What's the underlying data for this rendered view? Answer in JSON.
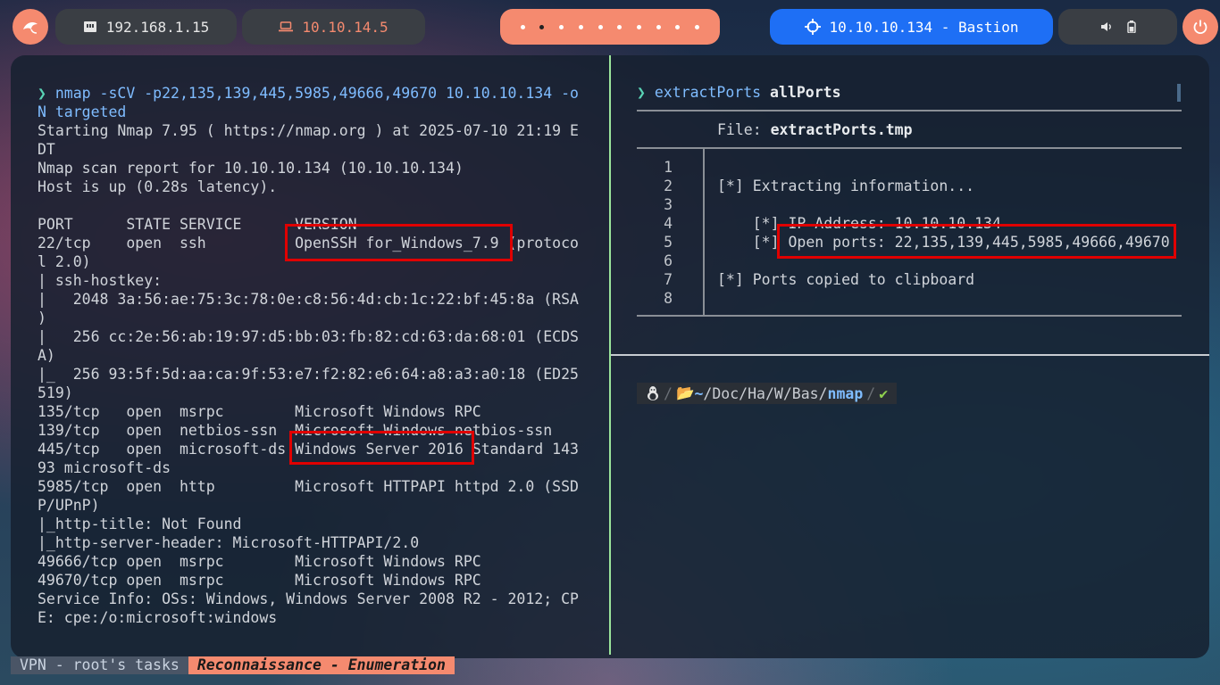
{
  "topbar": {
    "lan_ip": "192.168.1.15",
    "vpn_ip": "10.10.14.5",
    "target": "10.10.10.134 - Bastion",
    "icons": {
      "logo": "kali-dragon-icon",
      "lan": "ethernet-icon",
      "vpn": "laptop-icon",
      "target": "crosshair-icon",
      "volume": "volume-icon",
      "battery": "battery-icon",
      "power": "power-icon"
    },
    "workspace_dots": 10,
    "active_workspace": 2
  },
  "left_pane": {
    "lines": [
      "nmap -sCV -p22,135,139,445,5985,49666,49670 10.10.10.134 -o",
      "N targeted",
      "Starting Nmap 7.95 ( https://nmap.org ) at 2025-07-10 21:19 E",
      "DT",
      "Nmap scan report for 10.10.10.134 (10.10.10.134)",
      "Host is up (0.28s latency).",
      "",
      "PORT      STATE SERVICE      VERSION",
      "22/tcp    open  ssh          OpenSSH for_Windows_7.9 (protoco",
      "l 2.0)",
      "| ssh-hostkey:",
      "|   2048 3a:56:ae:75:3c:78:0e:c8:56:4d:cb:1c:22:bf:45:8a (RSA",
      ")",
      "|   256 cc:2e:56:ab:19:97:d5:bb:03:fb:82:cd:63:da:68:01 (ECDS",
      "A)",
      "|_  256 93:5f:5d:aa:ca:9f:53:e7:f2:82:e6:64:a8:a3:a0:18 (ED25",
      "519)",
      "135/tcp   open  msrpc        Microsoft Windows RPC",
      "139/tcp   open  netbios-ssn  Microsoft Windows netbios-ssn",
      "445/tcp   open  microsoft-ds Windows Server 2016 Standard 143",
      "93 microsoft-ds",
      "5985/tcp  open  http         Microsoft HTTPAPI httpd 2.0 (SSD",
      "P/UPnP)",
      "|_http-title: Not Found",
      "|_http-server-header: Microsoft-HTTPAPI/2.0",
      "49666/tcp open  msrpc        Microsoft Windows RPC",
      "49670/tcp open  msrpc        Microsoft Windows RPC",
      "Service Info: OSs: Windows, Windows Server 2008 R2 - 2012; CP",
      "E: cpe:/o:microsoft:windows"
    ]
  },
  "right_pane": {
    "command": "extractPorts",
    "command_arg": " allPorts",
    "file_label": "File: ",
    "file_name": "extractPorts.tmp",
    "line_numbers": [
      "1",
      "2",
      "3",
      "4",
      "5",
      "6",
      "7",
      "8"
    ],
    "lines": [
      "",
      "[*] Extracting information...",
      "",
      "    [*] IP Address: 10.10.10.134",
      "    [*] Open ports: 22,135,139,445,5985,49666,49670",
      "",
      "[*] Ports copied to clipboard",
      ""
    ]
  },
  "prompt": {
    "os_icon": "linux-tux-icon",
    "home": "~",
    "path_parts": [
      "Doc",
      "Ha",
      "W",
      "Bas"
    ],
    "current_dir": "nmap",
    "status_icon": "✔"
  },
  "statusbar": {
    "session": "VPN - root's tasks",
    "window": "Reconnaissance - Enumeration"
  },
  "colors": {
    "accent": "#f58a6f",
    "target_blue": "#1e6ff5",
    "highlight_red": "#e00000",
    "pane_divider_green": "#9be49b"
  }
}
